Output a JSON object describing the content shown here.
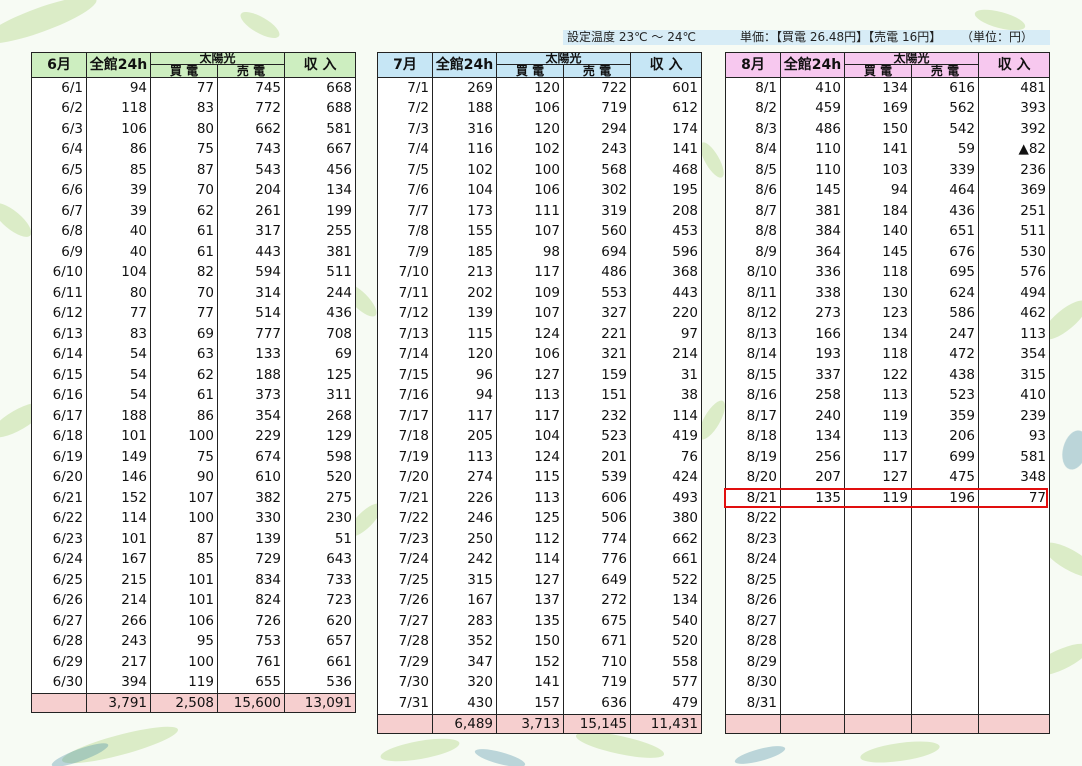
{
  "header": {
    "temperature": "設定温度 23℃ ～ 24℃",
    "price": "単価：【買電 26.48円】【売電 16円】",
    "unit": "（単位：円）"
  },
  "column_labels": {
    "total_24h": "全館24h",
    "solar": "太陽光",
    "buy": "買 電",
    "sell": "売 電",
    "income": "収 入"
  },
  "months": [
    {
      "label": "6月",
      "rows": [
        [
          "6/1",
          "94",
          "77",
          "745",
          "668"
        ],
        [
          "6/2",
          "118",
          "83",
          "772",
          "688"
        ],
        [
          "6/3",
          "106",
          "80",
          "662",
          "581"
        ],
        [
          "6/4",
          "86",
          "75",
          "743",
          "667"
        ],
        [
          "6/5",
          "85",
          "87",
          "543",
          "456"
        ],
        [
          "6/6",
          "39",
          "70",
          "204",
          "134"
        ],
        [
          "6/7",
          "39",
          "62",
          "261",
          "199"
        ],
        [
          "6/8",
          "40",
          "61",
          "317",
          "255"
        ],
        [
          "6/9",
          "40",
          "61",
          "443",
          "381"
        ],
        [
          "6/10",
          "104",
          "82",
          "594",
          "511"
        ],
        [
          "6/11",
          "80",
          "70",
          "314",
          "244"
        ],
        [
          "6/12",
          "77",
          "77",
          "514",
          "436"
        ],
        [
          "6/13",
          "83",
          "69",
          "777",
          "708"
        ],
        [
          "6/14",
          "54",
          "63",
          "133",
          "69"
        ],
        [
          "6/15",
          "54",
          "62",
          "188",
          "125"
        ],
        [
          "6/16",
          "54",
          "61",
          "373",
          "311"
        ],
        [
          "6/17",
          "188",
          "86",
          "354",
          "268"
        ],
        [
          "6/18",
          "101",
          "100",
          "229",
          "129"
        ],
        [
          "6/19",
          "149",
          "75",
          "674",
          "598"
        ],
        [
          "6/20",
          "146",
          "90",
          "610",
          "520"
        ],
        [
          "6/21",
          "152",
          "107",
          "382",
          "275"
        ],
        [
          "6/22",
          "114",
          "100",
          "330",
          "230"
        ],
        [
          "6/23",
          "101",
          "87",
          "139",
          "51"
        ],
        [
          "6/24",
          "167",
          "85",
          "729",
          "643"
        ],
        [
          "6/25",
          "215",
          "101",
          "834",
          "733"
        ],
        [
          "6/26",
          "214",
          "101",
          "824",
          "723"
        ],
        [
          "6/27",
          "266",
          "106",
          "726",
          "620"
        ],
        [
          "6/28",
          "243",
          "95",
          "753",
          "657"
        ],
        [
          "6/29",
          "217",
          "100",
          "761",
          "661"
        ],
        [
          "6/30",
          "394",
          "119",
          "655",
          "536"
        ]
      ],
      "totals": [
        "",
        "3,791",
        "2,508",
        "15,600",
        "13,091"
      ]
    },
    {
      "label": "7月",
      "rows": [
        [
          "7/1",
          "269",
          "120",
          "722",
          "601"
        ],
        [
          "7/2",
          "188",
          "106",
          "719",
          "612"
        ],
        [
          "7/3",
          "316",
          "120",
          "294",
          "174"
        ],
        [
          "7/4",
          "116",
          "102",
          "243",
          "141"
        ],
        [
          "7/5",
          "102",
          "100",
          "568",
          "468"
        ],
        [
          "7/6",
          "104",
          "106",
          "302",
          "195"
        ],
        [
          "7/7",
          "173",
          "111",
          "319",
          "208"
        ],
        [
          "7/8",
          "155",
          "107",
          "560",
          "453"
        ],
        [
          "7/9",
          "185",
          "98",
          "694",
          "596"
        ],
        [
          "7/10",
          "213",
          "117",
          "486",
          "368"
        ],
        [
          "7/11",
          "202",
          "109",
          "553",
          "443"
        ],
        [
          "7/12",
          "139",
          "107",
          "327",
          "220"
        ],
        [
          "7/13",
          "115",
          "124",
          "221",
          "97"
        ],
        [
          "7/14",
          "120",
          "106",
          "321",
          "214"
        ],
        [
          "7/15",
          "96",
          "127",
          "159",
          "31"
        ],
        [
          "7/16",
          "94",
          "113",
          "151",
          "38"
        ],
        [
          "7/17",
          "117",
          "117",
          "232",
          "114"
        ],
        [
          "7/18",
          "205",
          "104",
          "523",
          "419"
        ],
        [
          "7/19",
          "113",
          "124",
          "201",
          "76"
        ],
        [
          "7/20",
          "274",
          "115",
          "539",
          "424"
        ],
        [
          "7/21",
          "226",
          "113",
          "606",
          "493"
        ],
        [
          "7/22",
          "246",
          "125",
          "506",
          "380"
        ],
        [
          "7/23",
          "250",
          "112",
          "774",
          "662"
        ],
        [
          "7/24",
          "242",
          "114",
          "776",
          "661"
        ],
        [
          "7/25",
          "315",
          "127",
          "649",
          "522"
        ],
        [
          "7/26",
          "167",
          "137",
          "272",
          "134"
        ],
        [
          "7/27",
          "283",
          "135",
          "675",
          "540"
        ],
        [
          "7/28",
          "352",
          "150",
          "671",
          "520"
        ],
        [
          "7/29",
          "347",
          "152",
          "710",
          "558"
        ],
        [
          "7/30",
          "320",
          "141",
          "719",
          "577"
        ],
        [
          "7/31",
          "430",
          "157",
          "636",
          "479"
        ]
      ],
      "totals": [
        "",
        "6,489",
        "3,713",
        "15,145",
        "11,431"
      ]
    },
    {
      "label": "8月",
      "rows": [
        [
          "8/1",
          "410",
          "134",
          "616",
          "481"
        ],
        [
          "8/2",
          "459",
          "169",
          "562",
          "393"
        ],
        [
          "8/3",
          "486",
          "150",
          "542",
          "392"
        ],
        [
          "8/4",
          "110",
          "141",
          "59",
          "▲82"
        ],
        [
          "8/5",
          "110",
          "103",
          "339",
          "236"
        ],
        [
          "8/6",
          "145",
          "94",
          "464",
          "369"
        ],
        [
          "8/7",
          "381",
          "184",
          "436",
          "251"
        ],
        [
          "8/8",
          "384",
          "140",
          "651",
          "511"
        ],
        [
          "8/9",
          "364",
          "145",
          "676",
          "530"
        ],
        [
          "8/10",
          "336",
          "118",
          "695",
          "576"
        ],
        [
          "8/11",
          "338",
          "130",
          "624",
          "494"
        ],
        [
          "8/12",
          "273",
          "123",
          "586",
          "462"
        ],
        [
          "8/13",
          "166",
          "134",
          "247",
          "113"
        ],
        [
          "8/14",
          "193",
          "118",
          "472",
          "354"
        ],
        [
          "8/15",
          "337",
          "122",
          "438",
          "315"
        ],
        [
          "8/16",
          "258",
          "113",
          "523",
          "410"
        ],
        [
          "8/17",
          "240",
          "119",
          "359",
          "239"
        ],
        [
          "8/18",
          "134",
          "113",
          "206",
          "93"
        ],
        [
          "8/19",
          "256",
          "117",
          "699",
          "581"
        ],
        [
          "8/20",
          "207",
          "127",
          "475",
          "348"
        ],
        [
          "8/21",
          "135",
          "119",
          "196",
          "77"
        ],
        [
          "8/22",
          "",
          "",
          "",
          ""
        ],
        [
          "8/23",
          "",
          "",
          "",
          ""
        ],
        [
          "8/24",
          "",
          "",
          "",
          ""
        ],
        [
          "8/25",
          "",
          "",
          "",
          ""
        ],
        [
          "8/26",
          "",
          "",
          "",
          ""
        ],
        [
          "8/27",
          "",
          "",
          "",
          ""
        ],
        [
          "8/28",
          "",
          "",
          "",
          ""
        ],
        [
          "8/29",
          "",
          "",
          "",
          ""
        ],
        [
          "8/30",
          "",
          "",
          "",
          ""
        ],
        [
          "8/31",
          "",
          "",
          "",
          ""
        ]
      ],
      "totals": [
        "",
        "",
        "",
        "",
        ""
      ]
    }
  ],
  "highlight_row": "8/21",
  "colors": {
    "june_header": "#cdeec0",
    "july_header": "#c6e6f5",
    "august_header": "#f7c8ef",
    "totals_row": "#f6cfcf",
    "highlight_border": "#e10e0e"
  }
}
